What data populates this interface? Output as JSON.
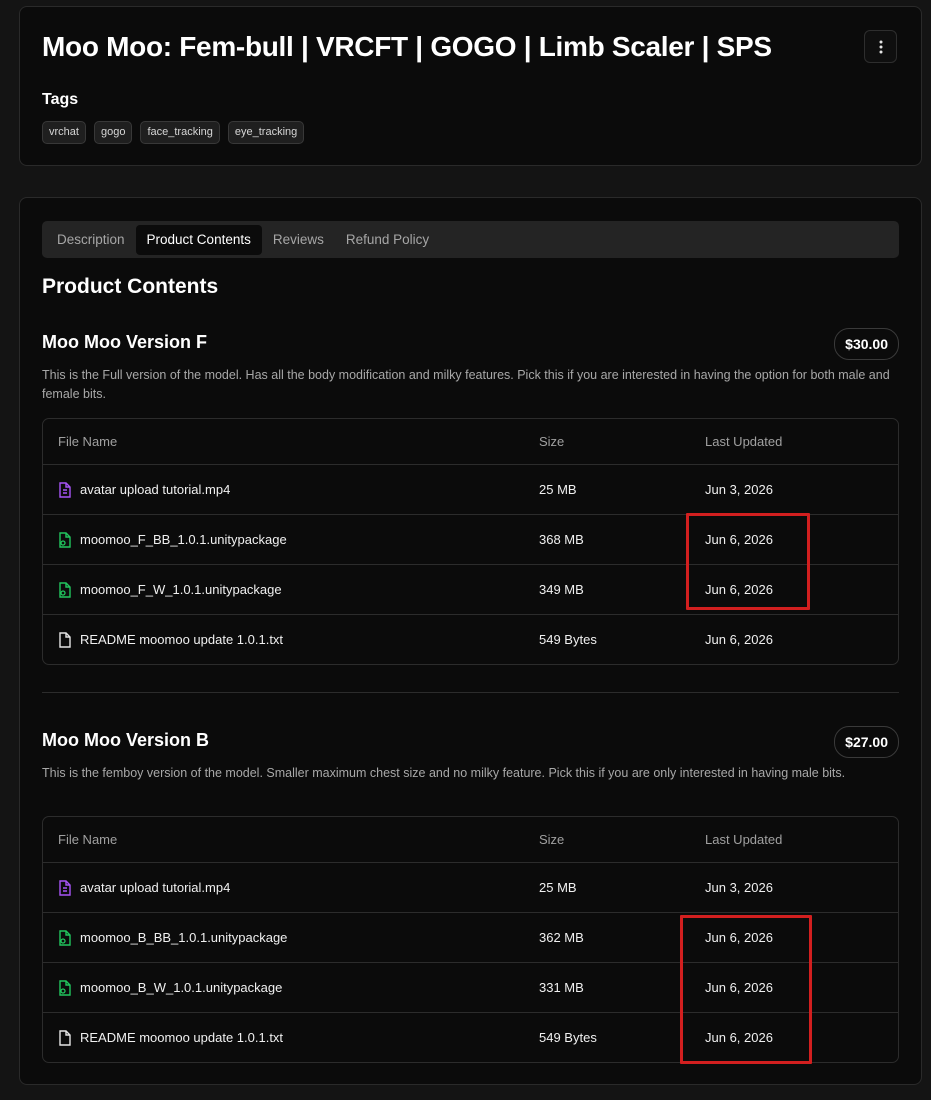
{
  "header": {
    "title": "Moo Moo: Fem-bull | VRCFT | GOGO | Limb Scaler | SPS",
    "more_icon": "vertical-dots-icon",
    "tags_heading": "Tags",
    "tags": [
      "vrchat",
      "gogo",
      "face_tracking",
      "eye_tracking"
    ]
  },
  "tabs": [
    {
      "label": "Description",
      "active": false
    },
    {
      "label": "Product Contents",
      "active": true
    },
    {
      "label": "Reviews",
      "active": false
    },
    {
      "label": "Refund Policy",
      "active": false
    }
  ],
  "section_title": "Product Contents",
  "table_headers": {
    "name": "File Name",
    "size": "Size",
    "updated": "Last Updated"
  },
  "products": [
    {
      "name": "Moo Moo Version F",
      "price": "$30.00",
      "description": "This is the Full version of the model. Has all the body modification and milky features. Pick this if you are interested in having the option for both male and female bits.",
      "files": [
        {
          "icon": "video-file-icon",
          "name": "avatar upload tutorial.mp4",
          "size": "25 MB",
          "updated": "Jun 3, 2026"
        },
        {
          "icon": "package-file-icon",
          "name": "moomoo_F_BB_1.0.1.unitypackage",
          "size": "368 MB",
          "updated": "Jun 6, 2026"
        },
        {
          "icon": "package-file-icon",
          "name": "moomoo_F_W_1.0.1.unitypackage",
          "size": "349 MB",
          "updated": "Jun 6, 2026"
        },
        {
          "icon": "text-file-icon",
          "name": "README moomoo update 1.0.1.txt",
          "size": "549 Bytes",
          "updated": "Jun 6, 2026"
        }
      ]
    },
    {
      "name": "Moo Moo Version B",
      "price": "$27.00",
      "description": "This is the femboy version of the model. Smaller maximum chest size and no milky feature. Pick this if you are only interested in having male bits.",
      "files": [
        {
          "icon": "video-file-icon",
          "name": "avatar upload tutorial.mp4",
          "size": "25 MB",
          "updated": "Jun 3, 2026"
        },
        {
          "icon": "package-file-icon",
          "name": "moomoo_B_BB_1.0.1.unitypackage",
          "size": "362 MB",
          "updated": "Jun 6, 2026"
        },
        {
          "icon": "package-file-icon",
          "name": "moomoo_B_W_1.0.1.unitypackage",
          "size": "331 MB",
          "updated": "Jun 6, 2026"
        },
        {
          "icon": "text-file-icon",
          "name": "README moomoo update 1.0.1.txt",
          "size": "549 Bytes",
          "updated": "Jun 6, 2026"
        }
      ]
    }
  ],
  "colors": {
    "background": "#141414",
    "card": "#0b0b0b",
    "video_icon": "#a855f7",
    "package_icon": "#22c55e",
    "text_icon": "#e5e5e5",
    "annotation_box": "#d21f1f"
  }
}
